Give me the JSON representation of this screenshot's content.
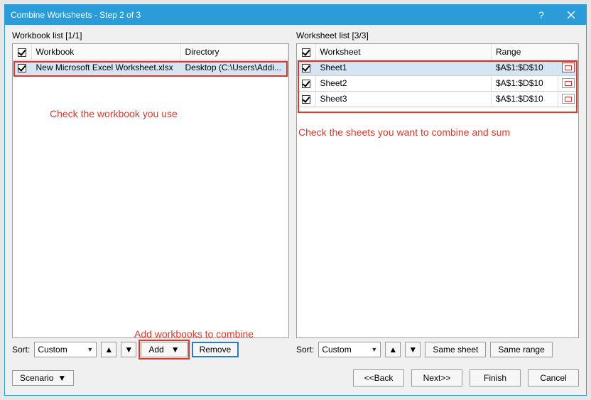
{
  "window": {
    "title": "Combine Worksheets - Step 2 of 3"
  },
  "left": {
    "label": "Workbook list [1/1]",
    "col_workbook": "Workbook",
    "col_directory": "Directory",
    "rows": [
      {
        "name": "New Microsoft Excel Worksheet.xlsx",
        "dir": "Desktop (C:\\Users\\Addi..."
      }
    ],
    "sort_label": "Sort:",
    "sort_value": "Custom",
    "add": "Add",
    "remove": "Remove"
  },
  "right": {
    "label": "Worksheet list [3/3]",
    "col_worksheet": "Worksheet",
    "col_range": "Range",
    "rows": [
      {
        "name": "Sheet1",
        "range": "$A$1:$D$10",
        "active": true
      },
      {
        "name": "Sheet2",
        "range": "$A$1:$D$10",
        "active": false
      },
      {
        "name": "Sheet3",
        "range": "$A$1:$D$10",
        "active": false
      }
    ],
    "sort_label": "Sort:",
    "sort_value": "Custom",
    "same_sheet": "Same sheet",
    "same_range": "Same range"
  },
  "annotations": {
    "check_workbook": "Check the workbook you use",
    "check_sheets": "Check the sheets you want to combine and sum",
    "add_workbooks": "Add workbooks to combine"
  },
  "footer": {
    "scenario": "Scenario",
    "back": "<<Back",
    "next": "Next>>",
    "finish": "Finish",
    "cancel": "Cancel"
  }
}
